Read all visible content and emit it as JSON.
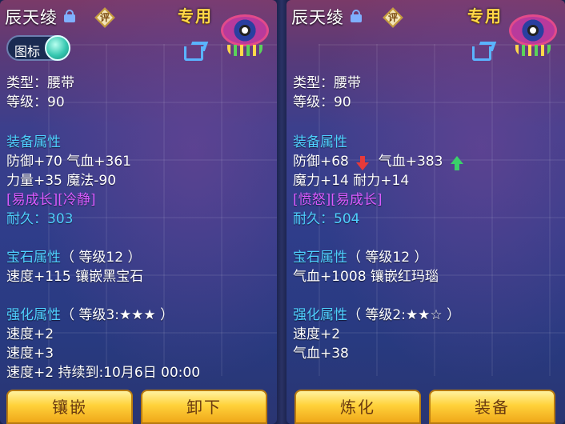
{
  "left": {
    "name": "辰天绫",
    "eval": "评",
    "exclusive": "专用",
    "toggle_label": "图标",
    "type": "类型：腰带",
    "level": "等级：90",
    "equip_header": "装备属性",
    "attr1": "防御+70 气血+361",
    "attr2": "力量+35 魔法-90",
    "tags": "[易成长][冷静]",
    "durability": "耐久：303",
    "gem_header": "宝石属性",
    "gem_level": "（ 等级12 ）",
    "gem_attr": "速度+115 镶嵌黑宝石",
    "enh_header": "强化属性",
    "enh_level": "（ 等级3:★★★ ）",
    "enh1": "速度+2",
    "enh2": "速度+3",
    "enh3": "速度+2    持续到:10月6日 00:00",
    "button1": "镶嵌",
    "button2": "卸下"
  },
  "right": {
    "name": "辰天绫",
    "eval": "评",
    "exclusive": "专用",
    "type": "类型：腰带",
    "level": "等级：90",
    "equip_header": "装备属性",
    "attr1a": "防御+68",
    "attr1b": "气血+383",
    "attr2": "魔力+14 耐力+14",
    "tags": "[愤怒][易成长]",
    "durability": "耐久：504",
    "gem_header": "宝石属性",
    "gem_level": "（ 等级12 ）",
    "gem_attr": "气血+1008 镶嵌红玛瑙",
    "enh_header": "强化属性",
    "enh_level": "（ 等级2:★★☆ ）",
    "enh1": "速度+2",
    "enh2": "气血+38",
    "button1": "炼化",
    "button2": "装备"
  },
  "icons": {
    "lock": "lock-icon",
    "eval": "evaluate-icon",
    "share": "share-icon",
    "badge": "mask-badge-icon",
    "up": "arrow-up-icon",
    "down": "arrow-down-icon"
  },
  "colors": {
    "header": "#4fd0ff",
    "purple_tag": "#d95bff",
    "exclusive": "#ffd84a",
    "up": "#3ad06a",
    "down": "#e63a3a"
  }
}
